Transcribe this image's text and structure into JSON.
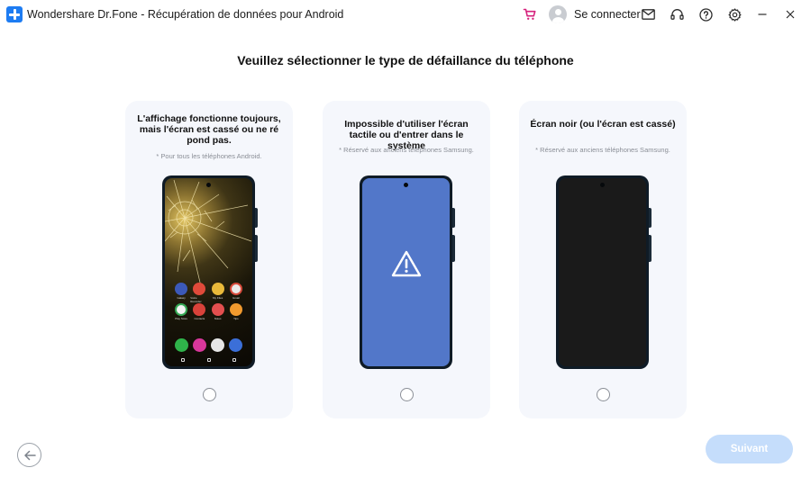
{
  "titlebar": {
    "app_title": "Wondershare Dr.Fone - Récupération de données pour Android",
    "login_label": "Se connecter",
    "icons": [
      "app-logo",
      "cart-icon",
      "avatar",
      "mail-icon",
      "headset-icon",
      "help-icon",
      "gear-icon",
      "minimize-icon",
      "close-icon"
    ]
  },
  "main": {
    "heading": "Veuillez sélectionner le type de défaillance du téléphone",
    "options": [
      {
        "title": "L'affichage fonctionne toujours, mais l'écran est cassé ou ne ré pond pas.",
        "note": "* Pour tous les téléphones Android.",
        "apps": [
          "Galaxy",
          "Voice Recorder",
          "My Files",
          "Gmail",
          "Play Store",
          "Contacts",
          "Notes",
          "Tips"
        ],
        "selected": false
      },
      {
        "title": "Impossible d'utiliser l'écran tactile ou d'entrer dans le système",
        "note": "* Réservé aux anciens téléphones Samsung.",
        "selected": false
      },
      {
        "title": "Écran noir (ou l'écran est cassé)",
        "note": "* Réservé aux anciens téléphones Samsung.",
        "selected": false
      }
    ]
  },
  "footer": {
    "next_label": "Suivant",
    "next_enabled": false
  },
  "colors": {
    "accent": "#1d7cf2",
    "next_disabled_bg": "#c5ddfb",
    "card_bg": "#f5f7fc",
    "blue_screen": "#5277c9"
  }
}
